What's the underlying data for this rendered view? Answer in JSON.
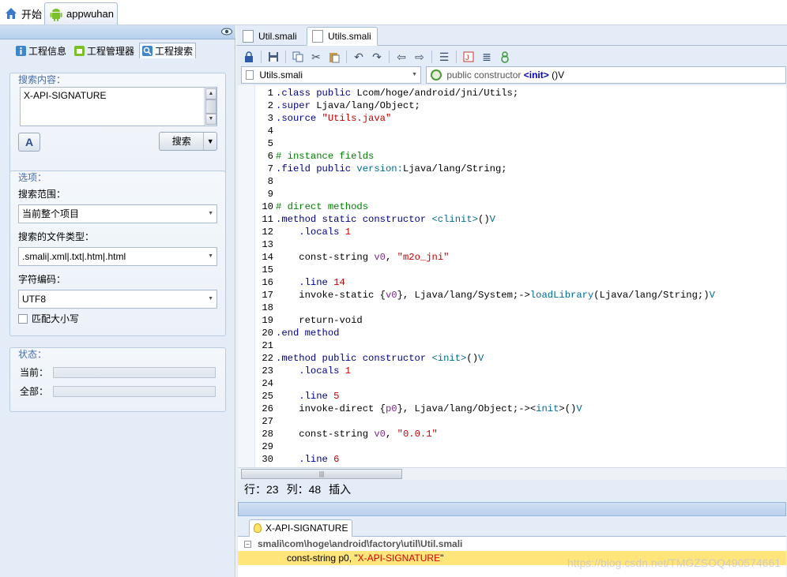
{
  "topbar": {
    "tabs": [
      {
        "label": "开始"
      },
      {
        "label": "appwuhan"
      }
    ]
  },
  "left_panel": {
    "tabs": [
      {
        "label": "工程信息"
      },
      {
        "label": "工程管理器"
      },
      {
        "label": "工程搜索"
      }
    ],
    "search_group": {
      "title": "搜索内容：",
      "query": "X-API-SIGNATURE",
      "search_button": "搜索"
    },
    "options_group": {
      "title": "选项：",
      "scope_label": "搜索范围：",
      "scope_value": "当前整个项目",
      "filetype_label": "搜索的文件类型：",
      "filetype_value": ".smali|.xml|.txt|.htm|.html",
      "encoding_label": "字符编码：",
      "encoding_value": "UTF8",
      "match_case_label": "匹配大小写"
    },
    "status_group": {
      "title": "状态：",
      "current_label": "当前：",
      "all_label": "全部："
    }
  },
  "editor": {
    "file_tabs": [
      {
        "label": "Util.smali"
      },
      {
        "label": "Utils.smali"
      }
    ],
    "file_selector": "Utils.smali",
    "member_selector_prefix": "public constructor ",
    "member_selector_kw": "<init>",
    "member_selector_suffix": " ()V",
    "status": {
      "row": "行：23",
      "col": "列：48",
      "mode": "插入"
    }
  },
  "code_lines": [
    {
      "n": "1",
      "parts": [
        [
          "dir",
          ".class "
        ],
        [
          "kw",
          "public "
        ],
        [
          "",
          "Lcom/hoge/android/jni/Utils;"
        ]
      ]
    },
    {
      "n": "2",
      "parts": [
        [
          "dir",
          ".super "
        ],
        [
          "",
          "Ljava/lang/Object;"
        ]
      ]
    },
    {
      "n": "3",
      "parts": [
        [
          "dir",
          ".source "
        ],
        [
          "str",
          "\"Utils.java\""
        ]
      ]
    },
    {
      "n": "4",
      "parts": []
    },
    {
      "n": "5",
      "parts": []
    },
    {
      "n": "6",
      "parts": [
        [
          "cm",
          "# instance fields"
        ]
      ]
    },
    {
      "n": "7",
      "parts": [
        [
          "dir",
          ".field "
        ],
        [
          "kw",
          "public "
        ],
        [
          "m",
          "version:"
        ],
        [
          "",
          "Ljava/lang/String;"
        ]
      ]
    },
    {
      "n": "8",
      "parts": []
    },
    {
      "n": "9",
      "parts": []
    },
    {
      "n": "10",
      "parts": [
        [
          "cm",
          "# direct methods"
        ]
      ]
    },
    {
      "n": "11",
      "parts": [
        [
          "dir",
          ".method "
        ],
        [
          "kw",
          "static constructor "
        ],
        [
          "m",
          "<clinit>"
        ],
        [
          "",
          "()"
        ],
        [
          "m",
          "V"
        ]
      ]
    },
    {
      "n": "12",
      "parts": [
        [
          "",
          "    "
        ],
        [
          "dir",
          ".locals "
        ],
        [
          "num",
          "1"
        ]
      ]
    },
    {
      "n": "13",
      "parts": []
    },
    {
      "n": "14",
      "parts": [
        [
          "",
          "    const-string "
        ],
        [
          "reg",
          "v0"
        ],
        [
          "",
          ", "
        ],
        [
          "str",
          "\"m2o_jni\""
        ]
      ]
    },
    {
      "n": "15",
      "parts": []
    },
    {
      "n": "16",
      "parts": [
        [
          "",
          "    "
        ],
        [
          "dir",
          ".line "
        ],
        [
          "num",
          "14"
        ]
      ]
    },
    {
      "n": "17",
      "parts": [
        [
          "",
          "    invoke-static {"
        ],
        [
          "reg",
          "v0"
        ],
        [
          "",
          "}, Ljava/lang/System;->"
        ],
        [
          "m",
          "loadLibrary"
        ],
        [
          "",
          "(Ljava/lang/String;)"
        ],
        [
          "m",
          "V"
        ]
      ]
    },
    {
      "n": "18",
      "parts": []
    },
    {
      "n": "19",
      "parts": [
        [
          "",
          "    return-void"
        ]
      ]
    },
    {
      "n": "20",
      "parts": [
        [
          "dir",
          ".end method"
        ]
      ]
    },
    {
      "n": "21",
      "parts": []
    },
    {
      "n": "22",
      "parts": [
        [
          "dir",
          ".method "
        ],
        [
          "kw",
          "public constructor "
        ],
        [
          "m",
          "<init>"
        ],
        [
          "",
          "()"
        ],
        [
          "m",
          "V"
        ]
      ]
    },
    {
      "n": "23",
      "parts": [
        [
          "",
          "    "
        ],
        [
          "dir",
          ".locals "
        ],
        [
          "num",
          "1"
        ]
      ]
    },
    {
      "n": "24",
      "parts": []
    },
    {
      "n": "25",
      "parts": [
        [
          "",
          "    "
        ],
        [
          "dir",
          ".line "
        ],
        [
          "num",
          "5"
        ]
      ]
    },
    {
      "n": "26",
      "parts": [
        [
          "",
          "    invoke-direct {"
        ],
        [
          "reg",
          "p0"
        ],
        [
          "",
          "}, Ljava/lang/Object;-><"
        ],
        [
          "m",
          "init"
        ],
        [
          "",
          ">()"
        ],
        [
          "m",
          "V"
        ]
      ]
    },
    {
      "n": "27",
      "parts": []
    },
    {
      "n": "28",
      "parts": [
        [
          "",
          "    const-string "
        ],
        [
          "reg",
          "v0"
        ],
        [
          "",
          ", "
        ],
        [
          "str",
          "\"0.0.1\""
        ]
      ]
    },
    {
      "n": "29",
      "parts": []
    },
    {
      "n": "30",
      "parts": [
        [
          "",
          "    "
        ],
        [
          "dir",
          ".line "
        ],
        [
          "num",
          "6"
        ]
      ]
    }
  ],
  "results": {
    "tab_label": "X-API-SIGNATURE",
    "file_path": "smali\\com\\hoge\\android\\factory\\util\\Util.smali",
    "hit_prefix": "const-string p0, \"",
    "hit_match": "X-API-SIGNATURE",
    "hit_suffix": "\""
  },
  "watermark": "https://blog.csdn.net/TMGZSOQ490574661"
}
